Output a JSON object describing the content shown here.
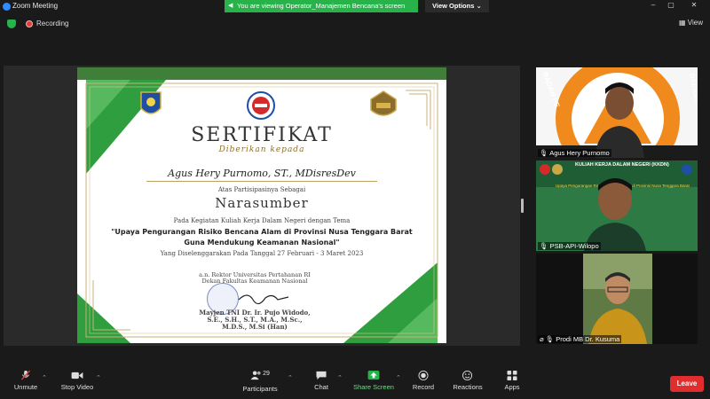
{
  "window": {
    "app_title": "Zoom Meeting",
    "minimize": "–",
    "maximize": "▢",
    "close": "✕"
  },
  "banner": {
    "text": "You are viewing Operator_Manajemen Bencana's screen",
    "view_options": "View Options ⌄"
  },
  "meeting": {
    "recording_label": "Recording",
    "view_label": "View"
  },
  "certificate": {
    "title": "SERTIFIKAT",
    "subtitle": "Diberikan kepada",
    "name": "Agus Hery Purnomo, ST., MDisresDev",
    "participation": "Atas Partisipasinya Sebagai",
    "role": "Narasumber",
    "activity": "Pada Kegiatan Kuliah Kerja Dalam Negeri dengan Tema",
    "theme_line1": "\"Upaya Pengurangan Risiko Bencana Alam di Provinsi Nusa Tenggara Barat",
    "theme_line2": "Guna Mendukung Keamanan Nasional\"",
    "date_line": "Yang Diselenggarakan Pada Tanggal 27 Februari - 3 Maret 2023",
    "signer_line1": "a.n. Rektor Universitas Pertahanan RI",
    "signer_line2": "Dekan Fakultas Keamanan Nasional",
    "signer_name1": "Mayjen TNI Dr. Ir. Pujo Widodo,",
    "signer_name2": "S.E., S.H., S.T., M.A., M.Sc.,",
    "signer_name3": "M.D.S., M.Si (Han)"
  },
  "participants_panel": [
    {
      "name": "Agus Hery Purnomo",
      "backdrop_text": "BADAN PENANGGULANGAN BENCANA DAERAH",
      "backdrop_left": "BADAN PE",
      "backdrop_right": "DAERAH"
    },
    {
      "name": "PSB-API-Wilopo",
      "backdrop_text": "KULIAH KERJA DALAM NEGERI (KKDN)",
      "backdrop_sub": "Upaya Pengurangan Risiko Bencana Alam di Provinsi Nusa Tenggara Barat"
    },
    {
      "name": "Prodi MB Dr. Kusuma"
    }
  ],
  "toolbar": {
    "unmute": "Unmute",
    "stop_video": "Stop Video",
    "participants": "Participants",
    "participants_count": "29",
    "chat": "Chat",
    "share_screen": "Share Screen",
    "record": "Record",
    "reactions": "Reactions",
    "apps": "Apps",
    "leave": "Leave"
  },
  "colors": {
    "banner_green": "#27b34a",
    "leave_red": "#e02d2d",
    "cert_green": "#2e9e3e"
  }
}
